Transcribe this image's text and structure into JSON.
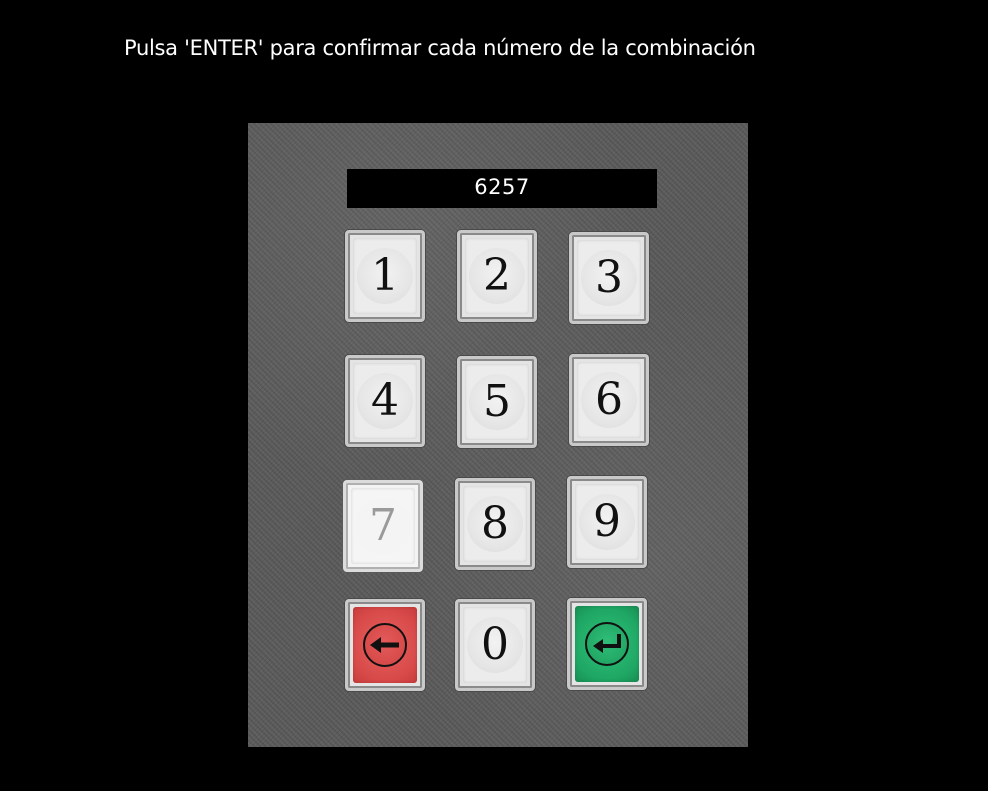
{
  "instruction": "Pulsa 'ENTER' para confirmar cada número de la combinación",
  "display": {
    "value": "6257"
  },
  "keypad": {
    "keys": [
      {
        "label": "1"
      },
      {
        "label": "2"
      },
      {
        "label": "3"
      },
      {
        "label": "4"
      },
      {
        "label": "5"
      },
      {
        "label": "6"
      },
      {
        "label": "7",
        "state": "pressed"
      },
      {
        "label": "8"
      },
      {
        "label": "9"
      },
      {
        "label": "0"
      }
    ],
    "backspace": {
      "icon": "arrow-left-icon",
      "color": "#d84a4a"
    },
    "enter": {
      "icon": "enter-return-icon",
      "color": "#1fa764"
    }
  },
  "colors": {
    "background": "#000000",
    "panel": "#5a5a5a",
    "display_bg": "#000000",
    "display_text": "#ffffff"
  }
}
